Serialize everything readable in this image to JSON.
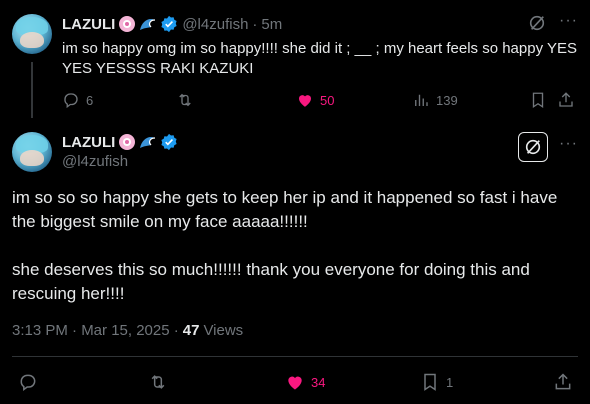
{
  "reply_parent": {
    "display_name": "LAZULI",
    "handle": "@l4zufish",
    "separator": "·",
    "time_ago": "5m",
    "text_line1": "im so happy omg im so happy!!!! she did it ; __ ; my heart feels so happy YES",
    "text_line2": "YES YESSSS RAKI KAZUKI",
    "replies": "6",
    "likes": "50",
    "views": "139"
  },
  "main_post": {
    "display_name": "LAZULI",
    "handle": "@l4zufish",
    "para1_line1": "im so so so happy she gets to keep her ip and it happened so fast i have",
    "para1_line2": "the biggest smile on my face aaaaa!!!!!!",
    "para2_line1": "she deserves this so much!!!!!! thank you everyone for doing this and",
    "para2_line2": "rescuing her!!!!",
    "timestamp": "3:13 PM · Mar 15, 2025 ·",
    "views_count": "47",
    "views_label": "Views",
    "likes": "34",
    "bookmarks": "1"
  },
  "colors": {
    "accent_like": "#f91880",
    "verified": "#1d9bf0",
    "muted": "#71767b"
  },
  "icons": [
    "reply-icon",
    "retweet-icon",
    "heart-icon",
    "views-icon",
    "bookmark-icon",
    "share-icon",
    "grok-icon",
    "more-icon",
    "verified-badge-icon"
  ]
}
